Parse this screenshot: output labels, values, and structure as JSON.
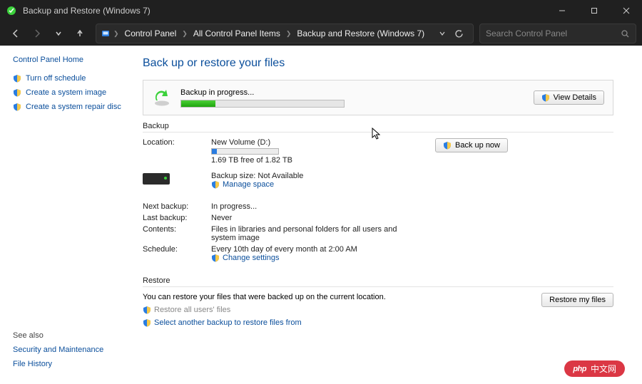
{
  "window": {
    "title": "Backup and Restore (Windows 7)",
    "minimize_tip": "Minimize",
    "maximize_tip": "Maximize",
    "close_tip": "Close"
  },
  "nav": {
    "back_tip": "Back",
    "forward_tip": "Forward",
    "recent_tip": "Recent locations",
    "up_tip": "Up",
    "refresh_tip": "Refresh",
    "search_placeholder": "Search Control Panel",
    "breadcrumbs": [
      "Control Panel",
      "All Control Panel Items",
      "Backup and Restore (Windows 7)"
    ]
  },
  "left": {
    "home": "Control Panel Home",
    "tasks": [
      "Turn off schedule",
      "Create a system image",
      "Create a system repair disc"
    ],
    "see_also_hdr": "See also",
    "see_also": [
      "Security and Maintenance",
      "File History"
    ]
  },
  "page": {
    "title": "Back up or restore your files",
    "progress_label": "Backup in progress...",
    "view_details": "View Details",
    "backup_hdr": "Backup",
    "restore_hdr": "Restore",
    "backup_now": "Back up now",
    "location_k": "Location:",
    "location_v": "New Volume (D:)",
    "free_space": "1.69 TB free of 1.82 TB",
    "backup_size": "Backup size: Not Available",
    "manage_space": "Manage space",
    "next_backup_k": "Next backup:",
    "next_backup_v": "In progress...",
    "last_backup_k": "Last backup:",
    "last_backup_v": "Never",
    "contents_k": "Contents:",
    "contents_v": "Files in libraries and personal folders for all users and system image",
    "schedule_k": "Schedule:",
    "schedule_v": "Every 10th day of every month at 2:00 AM",
    "change_settings": "Change settings",
    "restore_text": "You can restore your files that were backed up on the current location.",
    "restore_all": "Restore all users' files",
    "select_another": "Select another backup to restore files from",
    "restore_my_files": "Restore my files"
  },
  "watermark": {
    "logo": "php",
    "text": "中文网"
  }
}
